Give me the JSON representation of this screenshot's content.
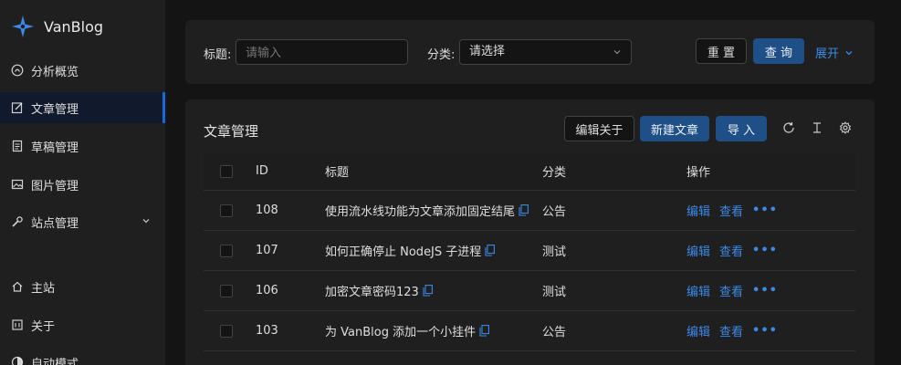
{
  "app": {
    "name": "VanBlog"
  },
  "sidebar": {
    "items": [
      {
        "label": "分析概览",
        "icon": "dashboard-icon"
      },
      {
        "label": "文章管理",
        "icon": "edit-icon",
        "active": true
      },
      {
        "label": "草稿管理",
        "icon": "draft-icon"
      },
      {
        "label": "图片管理",
        "icon": "image-icon"
      },
      {
        "label": "站点管理",
        "icon": "tool-icon",
        "expandable": true
      }
    ],
    "bottom_items": [
      {
        "label": "主站",
        "icon": "home-icon"
      },
      {
        "label": "关于",
        "icon": "about-icon"
      },
      {
        "label": "自动模式",
        "icon": "theme-icon"
      }
    ]
  },
  "filter": {
    "title_label": "标题:",
    "title_placeholder": "请输入",
    "category_label": "分类:",
    "category_placeholder": "请选择",
    "reset_label": "重 置",
    "search_label": "查 询",
    "expand_label": "展开"
  },
  "table": {
    "title": "文章管理",
    "edit_about_label": "编辑关于",
    "new_article_label": "新建文章",
    "import_label": "导 入",
    "columns": {
      "id": "ID",
      "title": "标题",
      "category": "分类",
      "actions": "操作"
    },
    "action_edit": "编辑",
    "action_view": "查看",
    "action_more": "•••",
    "rows": [
      {
        "id": "108",
        "title": "使用流水线功能为文章添加固定结尾",
        "category": "公告"
      },
      {
        "id": "107",
        "title": "如何正确停止 NodeJS 子进程",
        "category": "测试"
      },
      {
        "id": "106",
        "title": "加密文章密码123",
        "category": "测试"
      },
      {
        "id": "103",
        "title": "为 VanBlog 添加一个小挂件",
        "category": "公告"
      }
    ]
  },
  "colors": {
    "accent": "#1668dc",
    "link": "#3c89e8",
    "bg": "#141414",
    "card": "#1f1f1f"
  }
}
